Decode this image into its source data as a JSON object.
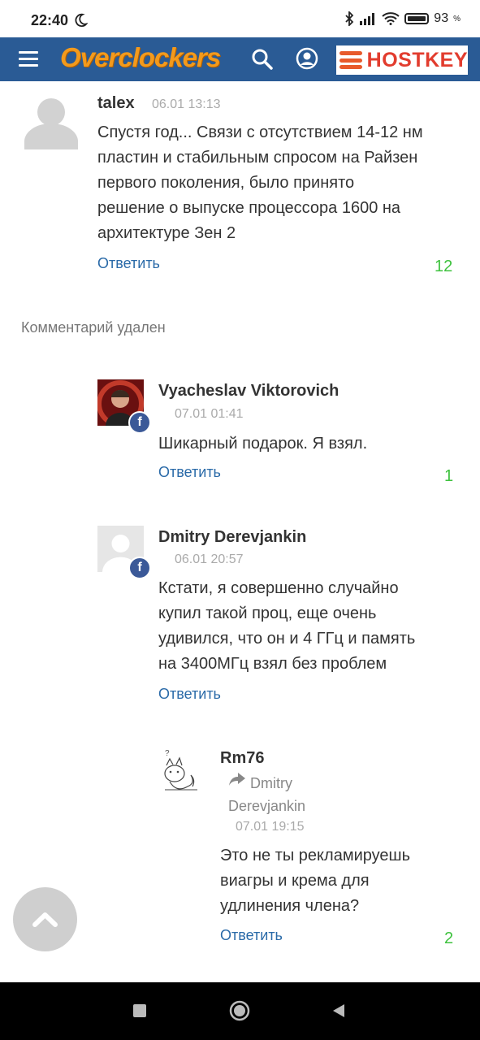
{
  "status_bar": {
    "time": "22:40",
    "battery": "93"
  },
  "header": {
    "logo": "Overclockers",
    "ad_brand": "HOSTKEY"
  },
  "comments": [
    {
      "author": "talex",
      "date": "06.01 13:13",
      "lines": [
        "Спустя год... Связи с отсутствием 14-12 нм",
        "пластин и стабильным спросом на Райзен",
        "первого поколения, было принято",
        "решение о выпуске процессора 1600 на",
        "архитектуре Зен 2"
      ],
      "reply": "Ответить",
      "rating": "12"
    },
    {
      "deleted_text": "Комментарий удален"
    },
    {
      "author": "Vyacheslav Viktorovich",
      "date": "07.01 01:41",
      "lines": [
        "Шикарный подарок. Я взял."
      ],
      "reply": "Ответить",
      "rating": "1"
    },
    {
      "author": "Dmitry Derevjankin",
      "date": "06.01 20:57",
      "lines": [
        "Кстати, я совершенно случайно",
        "купил такой проц, еще очень",
        "удивился, что он и 4 ГГц и память",
        "на 3400МГц взял без проблем"
      ],
      "reply": "Ответить"
    },
    {
      "author": "Rm76",
      "reply_to": [
        "Dmitry",
        "Derevjankin"
      ],
      "date": "07.01 19:15",
      "lines": [
        "Это не ты рекламируешь",
        "виагры и крема для",
        "удлинения члена?"
      ],
      "reply": "Ответить",
      "rating": "2"
    }
  ],
  "icons": [
    "menu-icon",
    "search-icon",
    "user-icon",
    "facebook-icon",
    "share-arrow-icon",
    "chevron-up-icon",
    "moon-icon",
    "bluetooth-icon",
    "signal-icon",
    "wifi-icon",
    "battery-icon",
    "back-icon",
    "home-icon",
    "recents-icon"
  ],
  "colors": {
    "header": "#2a5b95",
    "logo": "#f39a1c",
    "link": "#2a6aa8",
    "rating": "#3ec23e"
  }
}
